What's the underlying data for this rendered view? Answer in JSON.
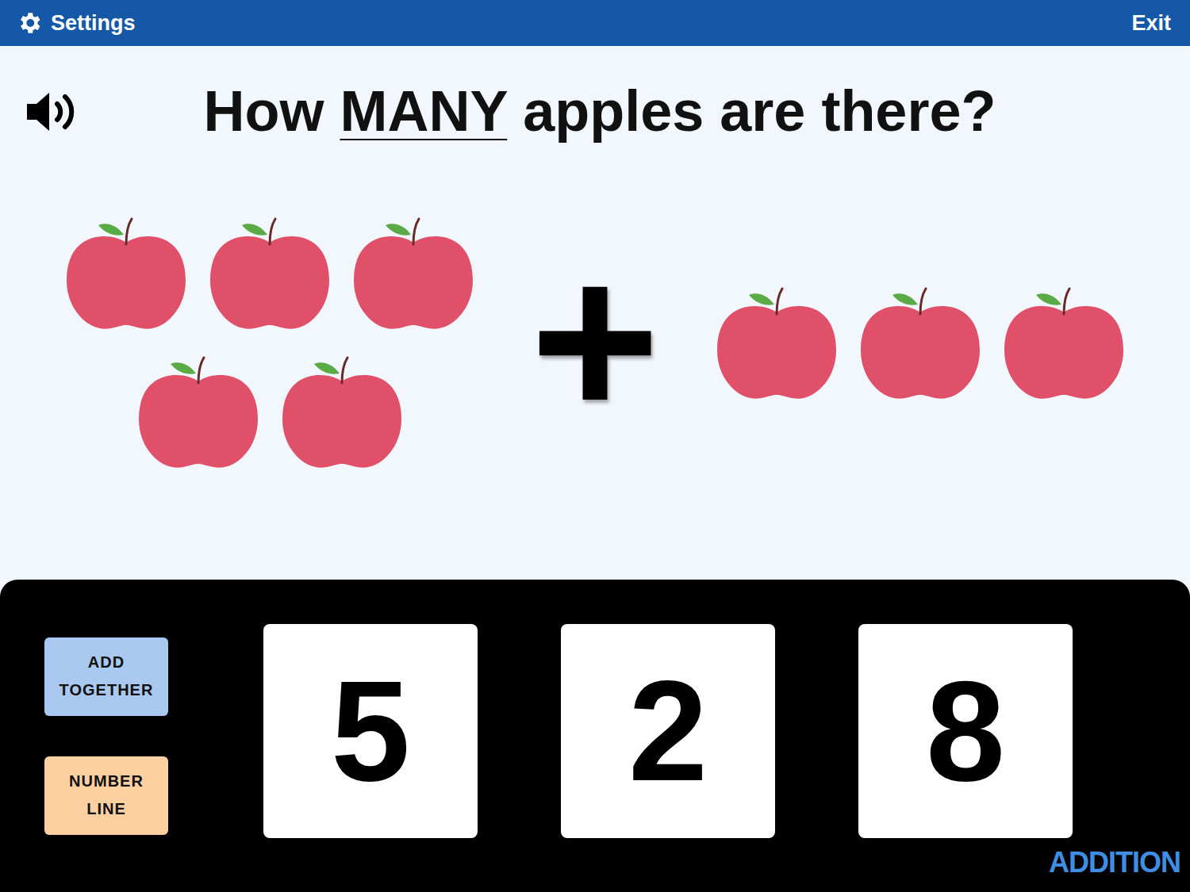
{
  "top_bar": {
    "settings": "Settings",
    "exit": "Exit"
  },
  "question": {
    "before": "How ",
    "emphasis": "MANY",
    "after": " apples are there?"
  },
  "addends": [
    {
      "count": 5
    },
    {
      "count": 3
    }
  ],
  "operator": "+",
  "tools": [
    {
      "label": "ADD TOGETHER",
      "color": "#a9c9f0"
    },
    {
      "label": "NUMBER LINE",
      "color": "#fdd0a2"
    }
  ],
  "answers": [
    {
      "label": "5"
    },
    {
      "label": "2"
    },
    {
      "label": "8"
    }
  ],
  "topic": "ADDITION"
}
